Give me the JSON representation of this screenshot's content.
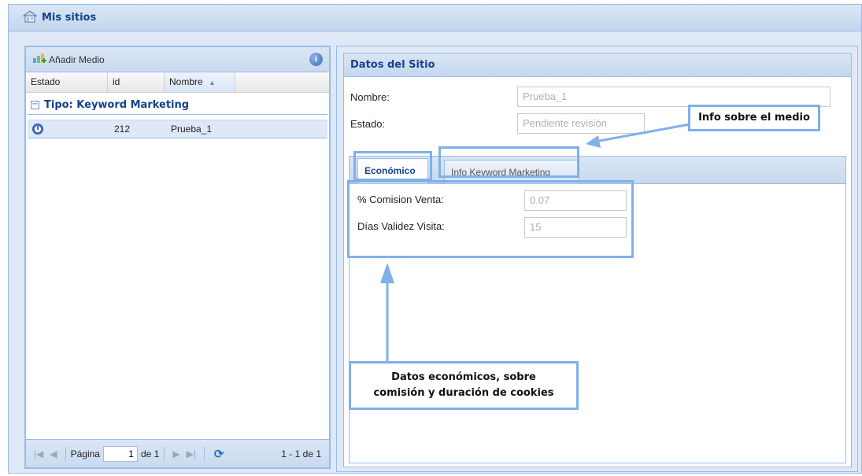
{
  "window": {
    "title": "Mis sitios"
  },
  "left_panel": {
    "add_label": "Añadir Medio",
    "columns": {
      "estado": "Estado",
      "id": "id",
      "nombre": "Nombre"
    },
    "sort_indicator": "▲",
    "group": {
      "toggle": "−",
      "label": "Tipo: Keyword Marketing"
    },
    "rows": [
      {
        "id": "212",
        "nombre": "Prueba_1"
      }
    ],
    "pager": {
      "page_label": "Página",
      "page_value": "1",
      "of_label": "de 1",
      "count": "1 - 1 de 1"
    }
  },
  "right_panel": {
    "title": "Datos del Sitio",
    "nombre_label": "Nombre:",
    "nombre_value": "Prueba_1",
    "estado_label": "Estado:",
    "estado_value": "Pendiente revisión",
    "tabs": [
      {
        "label": "Económico",
        "active": true
      },
      {
        "label": "Info Keyword Marketing",
        "active": false
      }
    ],
    "economico": {
      "comision_label": "% Comision Venta:",
      "comision_value": "0.07",
      "dias_label": "Días Validez Visita:",
      "dias_value": "15"
    }
  },
  "annotations": {
    "info_medio": "Info sobre el medio",
    "datos_line1": "Datos económicos, sobre",
    "datos_line2": "comisión y duración de cookies"
  },
  "colors": {
    "accent": "#15428b",
    "panel_border": "#99bbe8",
    "highlight": "#7fb0ea"
  }
}
